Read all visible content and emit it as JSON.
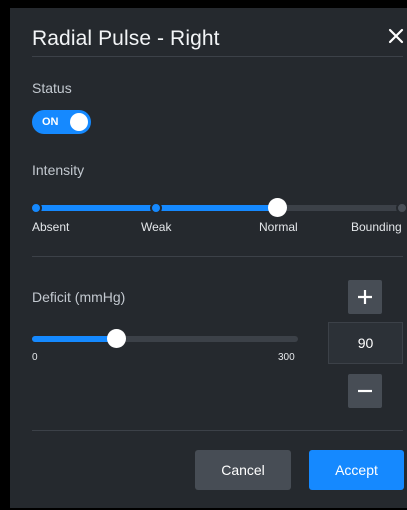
{
  "dialog": {
    "title": "Radial Pulse - Right",
    "close_icon": "close-icon"
  },
  "status": {
    "label": "Status",
    "toggle_text": "ON",
    "on": true
  },
  "intensity": {
    "label": "Intensity",
    "options": [
      "Absent",
      "Weak",
      "Normal",
      "Bounding"
    ],
    "selected": "Normal"
  },
  "deficit": {
    "label": "Deficit (mmHg)",
    "min_label": "0",
    "max_label": "300",
    "value": "90",
    "increment_icon": "plus-icon",
    "decrement_icon": "minus-icon"
  },
  "actions": {
    "cancel": "Cancel",
    "accept": "Accept"
  },
  "colors": {
    "accent": "#1589ff",
    "panel": "#25292e",
    "muted_button": "#474d55"
  }
}
